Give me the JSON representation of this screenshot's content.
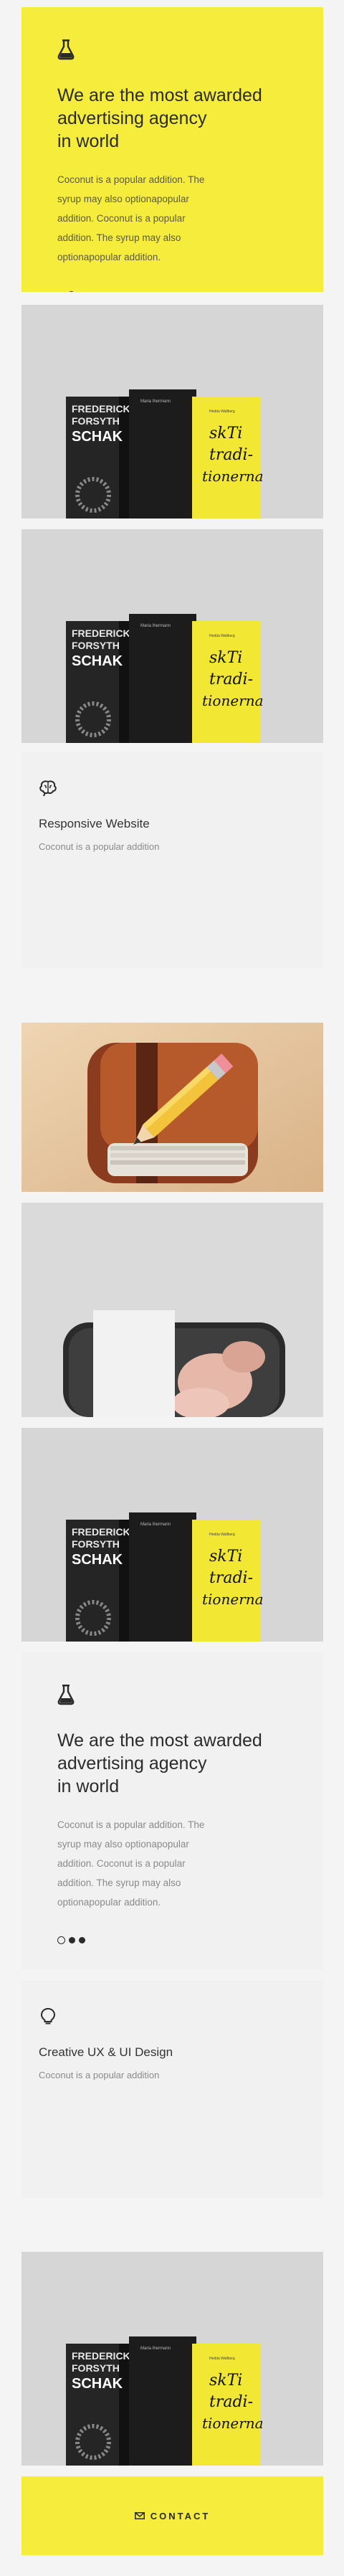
{
  "feature_top": {
    "heading_line1": "We are the most awarded",
    "heading_line2": "advertising agency",
    "heading_line3": "in world",
    "body_line1": "Coconut is a popular addition. The",
    "body_line2": "syrup may also optionapopular",
    "body_line3": "addition. Coconut is a popular",
    "body_line4": "addition. The syrup may also",
    "body_line5": "optionapopular addition.",
    "icon": "flask-icon"
  },
  "book": {
    "dark_title_line1": "FREDERICK",
    "dark_title_line2": "FORSYTH",
    "dark_title_line3": "SCHAK",
    "spine_text": "SCHAKALEN",
    "yellow_line1": "skTi",
    "yellow_line2": "tradi-",
    "yellow_line3": "tionerna",
    "small_author": "Maria Ihermann",
    "small_author2": "Hedda Wallberg"
  },
  "service1": {
    "icon": "brain-icon",
    "title": "Responsive Website",
    "subtitle": "Coconut is a popular addition"
  },
  "feature_mid": {
    "heading_line1": "We are the most awarded",
    "heading_line2": "advertising agency",
    "heading_line3": "in world",
    "body_line1": "Coconut is a popular addition. The",
    "body_line2": "syrup may also optionapopular",
    "body_line3": "addition. Coconut is a popular",
    "body_line4": "addition. The syrup may also",
    "body_line5": "optionapopular addition.",
    "icon": "flask-icon"
  },
  "service2": {
    "icon": "lightbulb-icon",
    "title": "Creative UX & UI Design",
    "subtitle": "Coconut is a popular addition"
  },
  "contact": {
    "label": "CONTACT",
    "icon": "envelope-icon"
  }
}
